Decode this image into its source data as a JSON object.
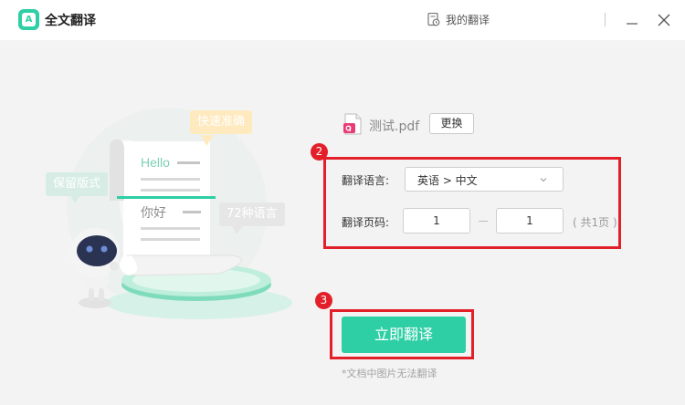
{
  "app": {
    "title": "全文翻译",
    "logo_letters": "A"
  },
  "titlebar": {
    "my_translations": "我的翻译"
  },
  "icons": {
    "logo": "translate-logo-icon",
    "my_translations": "document-clock-icon",
    "minimize": "minimize-icon",
    "close": "close-icon",
    "file": "pdf-file-icon",
    "dropdown": "chevron-down-icon"
  },
  "illustration": {
    "tags": {
      "fast": "快速准确",
      "keep_format": "保留版式",
      "languages": "72种语言"
    },
    "doc_text": {
      "source": "Hello",
      "target": "你好"
    }
  },
  "file": {
    "name": "测试.pdf",
    "change_label": "更换"
  },
  "form": {
    "language_label": "翻译语言:",
    "language_value": "英语 > 中文",
    "pages_label": "翻译页码:",
    "page_from": "1",
    "page_to": "1",
    "total_pages": "( 共1页 )"
  },
  "annotations": {
    "step2": "2",
    "step3": "3"
  },
  "action": {
    "translate_label": "立即翻译",
    "note": "*文档中图片无法翻译"
  },
  "colors": {
    "accent": "#2fcfa5",
    "highlight": "#e3202a",
    "background": "#f3f3f3"
  }
}
